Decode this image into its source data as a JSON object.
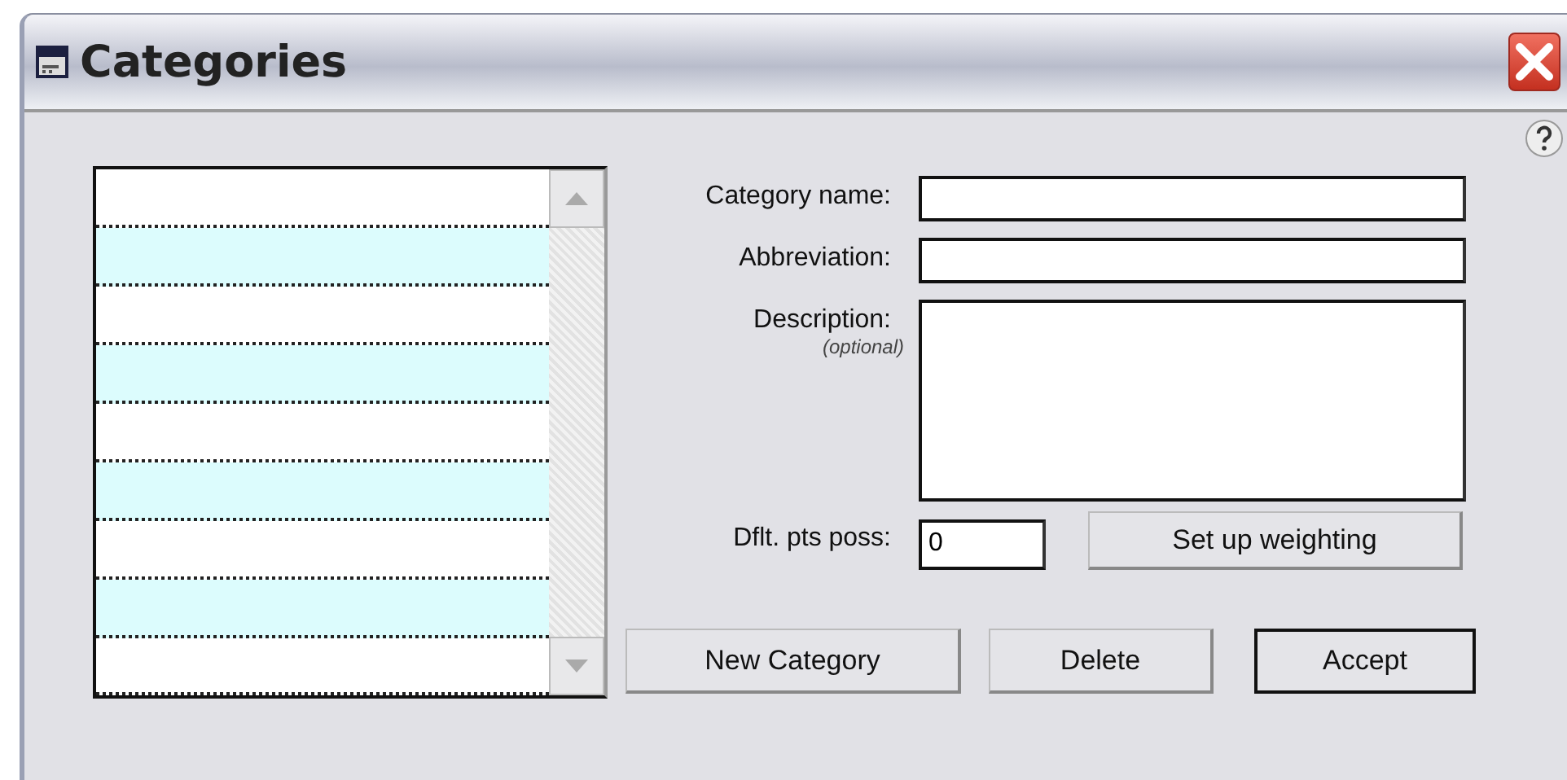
{
  "window": {
    "title": "Categories"
  },
  "form": {
    "fields": [
      {
        "label": "Category name:",
        "kind": "line"
      },
      {
        "label": "Abbreviation:",
        "kind": "line"
      },
      {
        "label": "Description:",
        "note": "(optional)",
        "kind": "area"
      }
    ],
    "points": {
      "label": "Dflt. pts poss:",
      "value": "0"
    },
    "weighting_button": "Set up weighting"
  },
  "buttons": [
    {
      "label": "New Category",
      "default": false
    },
    {
      "label": "Delete",
      "default": false
    },
    {
      "label": "Accept",
      "default": true
    }
  ]
}
